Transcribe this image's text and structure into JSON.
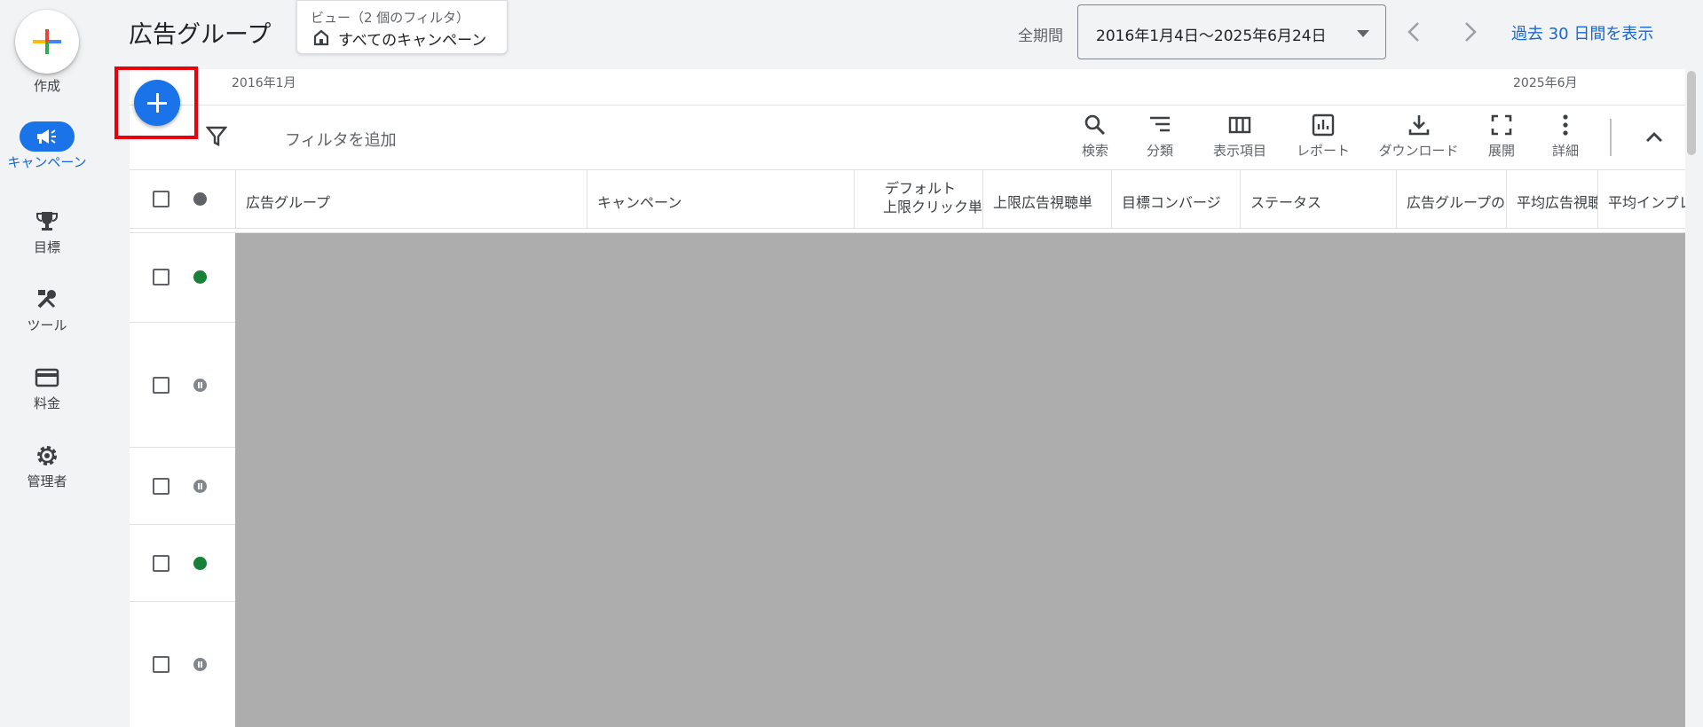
{
  "nav": {
    "create_label": "作成",
    "items": [
      {
        "label": "キャンペーン",
        "icon": "megaphone-icon",
        "active": true
      },
      {
        "label": "目標",
        "icon": "trophy-icon"
      },
      {
        "label": "ツール",
        "icon": "tools-icon"
      },
      {
        "label": "料金",
        "icon": "credit-card-icon"
      },
      {
        "label": "管理者",
        "icon": "gear-icon"
      }
    ]
  },
  "header": {
    "title": "広告グループ",
    "view_caption": "ビュー（2 個のフィルタ）",
    "view_value": "すべてのキャンペーン",
    "date_label": "全期間",
    "date_range": "2016年1月4日〜2025年6月24日",
    "last30_link": "過去 30 日間を表示"
  },
  "timeline": {
    "start": "2016年1月",
    "end": "2025年6月"
  },
  "toolbar": {
    "filter_label": "フィルタを追加",
    "tools": [
      {
        "label": "検索",
        "icon": "search-icon"
      },
      {
        "label": "分類",
        "icon": "segment-icon"
      },
      {
        "label": "表示項目",
        "icon": "columns-icon"
      },
      {
        "label": "レポート",
        "icon": "report-icon"
      },
      {
        "label": "ダウンロード",
        "icon": "download-icon"
      },
      {
        "label": "展開",
        "icon": "expand-icon"
      },
      {
        "label": "詳細",
        "icon": "more-vert-icon"
      }
    ]
  },
  "table": {
    "columns": [
      "広告グループ",
      "キャンペーン",
      "デフォルト上限クリック単",
      "上限広告視聴単",
      "目標コンバージ",
      "ステータス",
      "広告グループの",
      "平均広告視聴",
      "平均インプレ"
    ],
    "default_col_line1": "デフォルト",
    "default_col_line2": "上限クリック単",
    "row_statuses": [
      "enabled",
      "paused",
      "paused",
      "enabled",
      "paused"
    ]
  },
  "colors": {
    "accent": "#1a73e8",
    "enabled": "#188038",
    "paused": "#80868b",
    "highlight": "#e8000b"
  }
}
